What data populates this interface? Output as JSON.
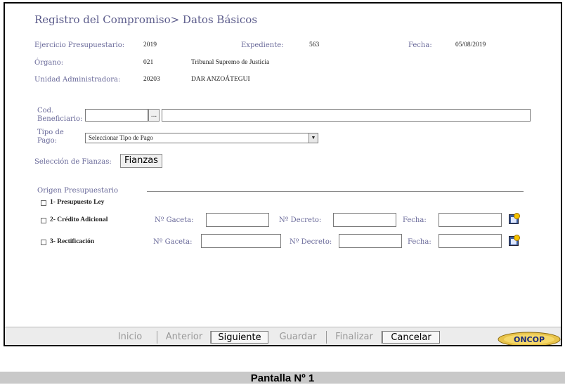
{
  "header": {
    "title": "Registro del Compromiso> Datos Básicos"
  },
  "info": {
    "ejercicio_label": "Ejercicio Presupuestario:",
    "ejercicio_value": "2019",
    "expediente_label": "Expediente:",
    "expediente_value": "563",
    "fecha_label": "Fecha:",
    "fecha_value": "05/08/2019",
    "organo_label": "Órgano:",
    "organo_code": "021",
    "organo_name": "Tribunal Supremo de Justicia",
    "unidad_label": "Unidad Administradora:",
    "unidad_code": "20203",
    "unidad_name": "DAR ANZOÁTEGUI"
  },
  "form": {
    "cod_label_1": "Cod.",
    "cod_label_2": "Beneficiario:",
    "browse_button": "...",
    "tipo_label_1": "Tipo de",
    "tipo_label_2": "Pago:",
    "tipo_selected": "Seleccionar Tipo de Pago",
    "fianzas_label": "Selección de Fianzas:",
    "fianzas_button": "Fianzas"
  },
  "origen": {
    "heading": "Origen Presupuestario",
    "opt1": "1- Presupuesto Ley",
    "opt2": "2- Crédito Adicional",
    "opt3": "3- Rectificación",
    "gaceta_label": "Nº Gaceta:",
    "decreto_label": "Nº Decreto:",
    "fecha_label": "Fecha:"
  },
  "nav": {
    "inicio": "Inicio",
    "anterior": "Anterior",
    "siguiente": "Siguiente",
    "guardar": "Guardar",
    "finalizar": "Finalizar",
    "cancelar": "Cancelar"
  },
  "logo": {
    "text": "ONCOP"
  },
  "caption": "Pantalla Nº 1"
}
